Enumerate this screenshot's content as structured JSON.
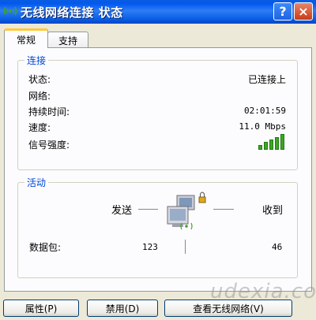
{
  "window": {
    "title": "无线网络连接 状态",
    "help_label": "?",
    "close_label": "×"
  },
  "tabs": [
    {
      "label": "常规",
      "active": true
    },
    {
      "label": "支持",
      "active": false
    }
  ],
  "connection": {
    "legend": "连接",
    "rows": [
      {
        "label": "状态:",
        "value": "已连接上"
      },
      {
        "label": "网络:",
        "value": ""
      },
      {
        "label": "持续时间:",
        "value": "02:01:59"
      },
      {
        "label": "速度:",
        "value": "11.0 Mbps"
      },
      {
        "label": "信号强度:",
        "value": ""
      }
    ],
    "signal_bars": 5,
    "signal_color": "#3fa524"
  },
  "activity": {
    "legend": "活动",
    "sent_label": "发送",
    "received_label": "收到",
    "packets_label": "数据包:",
    "packets_sent": "123",
    "packets_received": "46"
  },
  "buttons": {
    "properties": "属性(P)",
    "disable": "禁用(D)",
    "view_networks": "查看无线网络(V)"
  },
  "watermark": "udexia.com"
}
